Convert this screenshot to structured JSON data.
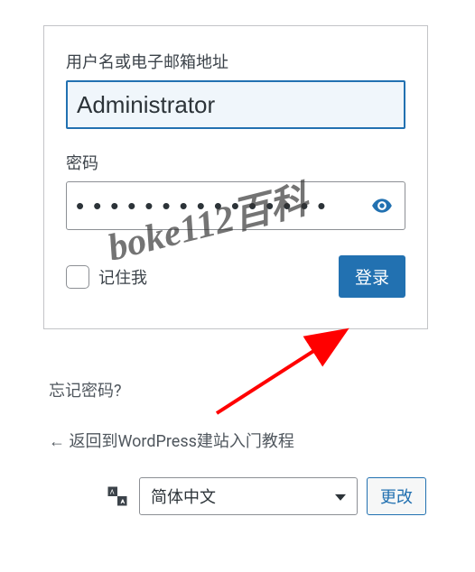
{
  "form": {
    "username_label": "用户名或电子邮箱地址",
    "username_value": "Administrator",
    "password_label": "密码",
    "password_value": "•••••••••••••••",
    "remember_label": "记住我",
    "login_button": "登录"
  },
  "links": {
    "lost_password": "忘记密码?",
    "back_to_site": "← 返回到WordPress建站入门教程"
  },
  "language": {
    "selected": "简体中文",
    "change_button": "更改"
  },
  "watermark": "boke112百科"
}
